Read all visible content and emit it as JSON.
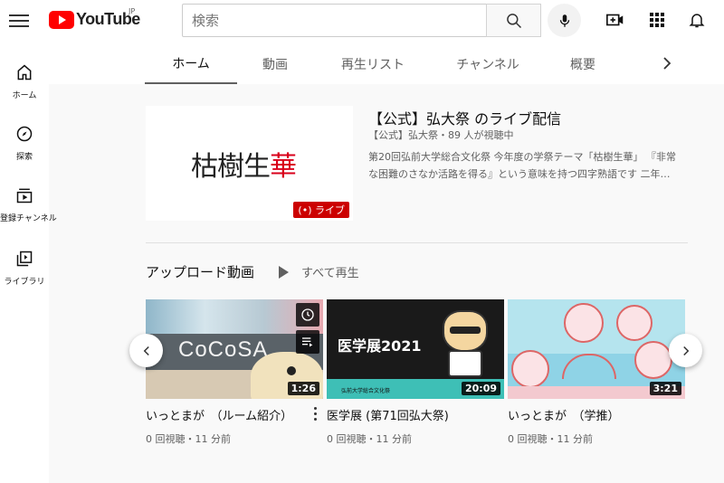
{
  "header": {
    "logo_text": "YouTube",
    "region": "JP",
    "search_placeholder": "検索"
  },
  "leftnav": [
    {
      "label": "ホーム",
      "icon": "home-icon"
    },
    {
      "label": "探索",
      "icon": "compass-icon"
    },
    {
      "label": "登録チャンネル",
      "icon": "subscriptions-icon"
    },
    {
      "label": "ライブラリ",
      "icon": "library-icon"
    }
  ],
  "tabs": [
    "ホーム",
    "動画",
    "再生リスト",
    "チャンネル",
    "概要"
  ],
  "featured": {
    "thumb_text_black": "枯樹生",
    "thumb_text_red": "華",
    "live_label": "ライブ",
    "title": "【公式】弘大祭 のライブ配信",
    "meta": "【公式】弘大祭・89 人が視聴中",
    "description": "第20回弘前大学総合文化祭 今年度の学祭テーマ「枯樹生華」 『非常な困難のさなか活路を得る』という意味を持つ四字熟語です 二年…"
  },
  "shelf": {
    "title": "アップロード動画",
    "play_all": "すべて再生"
  },
  "videos": [
    {
      "title": "いっとまが　（ルーム紹介）",
      "duration": "1:26",
      "meta": "0 回視聴・11 分前",
      "thumb_text": "CoCoSA"
    },
    {
      "title": "医学展 (第71回弘大祭)",
      "duration": "20:09",
      "meta": "0 回視聴・11 分前",
      "thumb_text": "医学展2021",
      "thumb_sub": "弘前大学総合文化祭"
    },
    {
      "title": "いっとまが　（学推）",
      "duration": "3:21",
      "meta": "0 回視聴・11 分前"
    }
  ],
  "colors": {
    "brand_red": "#ff0000",
    "live_red": "#cc0000",
    "thumb_teal": "#3ebfb6",
    "thumb_pink": "#f8d7da"
  }
}
